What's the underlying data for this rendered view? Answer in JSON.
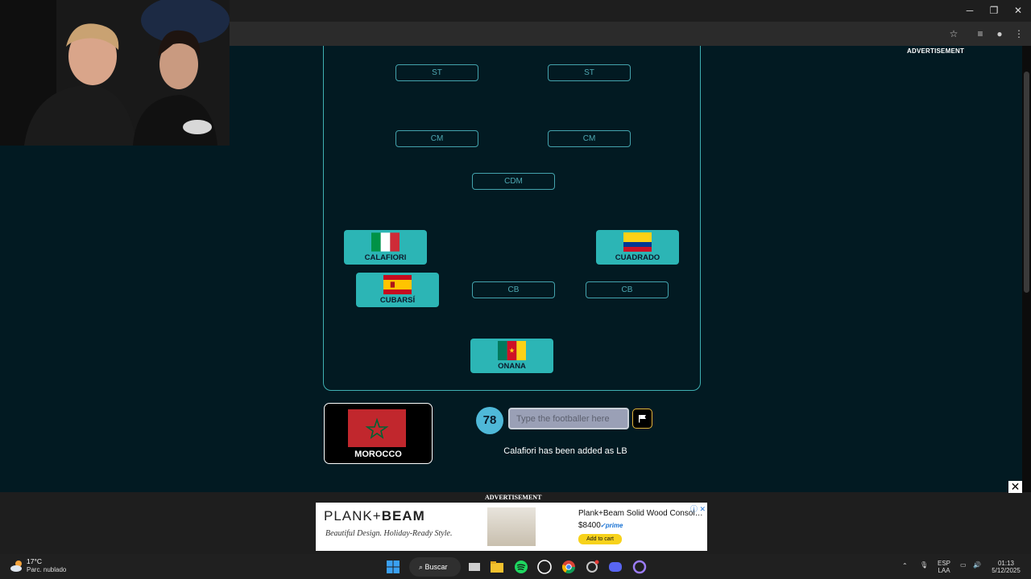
{
  "browser": {
    "controls": {
      "minimize": "─",
      "maximize": "❐",
      "close": "✕"
    },
    "toolbar_icons": {
      "star": "☆",
      "tab_search": "≡",
      "profile": "●",
      "menu": "⋮"
    }
  },
  "page": {
    "ad_top_label": "ADVERTISEMENT",
    "positions": {
      "st_left": "ST",
      "st_right": "ST",
      "cm_left": "CM",
      "cm_right": "CM",
      "cdm": "CDM",
      "cb_left": "CB",
      "cb_right": "CB"
    },
    "players": [
      {
        "name": "CALAFIORI",
        "flag": "italy"
      },
      {
        "name": "CUADRADO",
        "flag": "colombia"
      },
      {
        "name": "CUBARSÍ",
        "flag": "spain"
      },
      {
        "name": "ONANA",
        "flag": "cameroon"
      }
    ],
    "country": {
      "name": "MOROCCO",
      "flag": "morocco"
    },
    "score": "78",
    "input": {
      "placeholder": "Type the footballer here",
      "value": ""
    },
    "flag_button_icon": "flag-icon",
    "status_message": "Calafiori has been added as LB"
  },
  "ad": {
    "label": "ADVERTISEMENT",
    "close": "✕",
    "brand_prefix": "PLANK+",
    "brand_suffix": "BEAM",
    "tagline": "Beautiful Design. Holiday-Ready Style.",
    "product_title": "Plank+Beam Solid Wood Consol…",
    "price": "$8400",
    "prime": "✓prime",
    "cart": "Add to cart"
  },
  "taskbar": {
    "temperature": "17°C",
    "weather": "Parc. nublado",
    "search": "Buscar",
    "lang": "ESP",
    "region": "LAA",
    "time": "01:13",
    "date": "5/12/2025"
  },
  "colors": {
    "page_bg": "#021a22",
    "pitch_border": "#3fb0b2",
    "card_bg": "#2cb5b5",
    "score_bg": "#4fb8d8",
    "flag_btn_border": "#e5b53a"
  }
}
